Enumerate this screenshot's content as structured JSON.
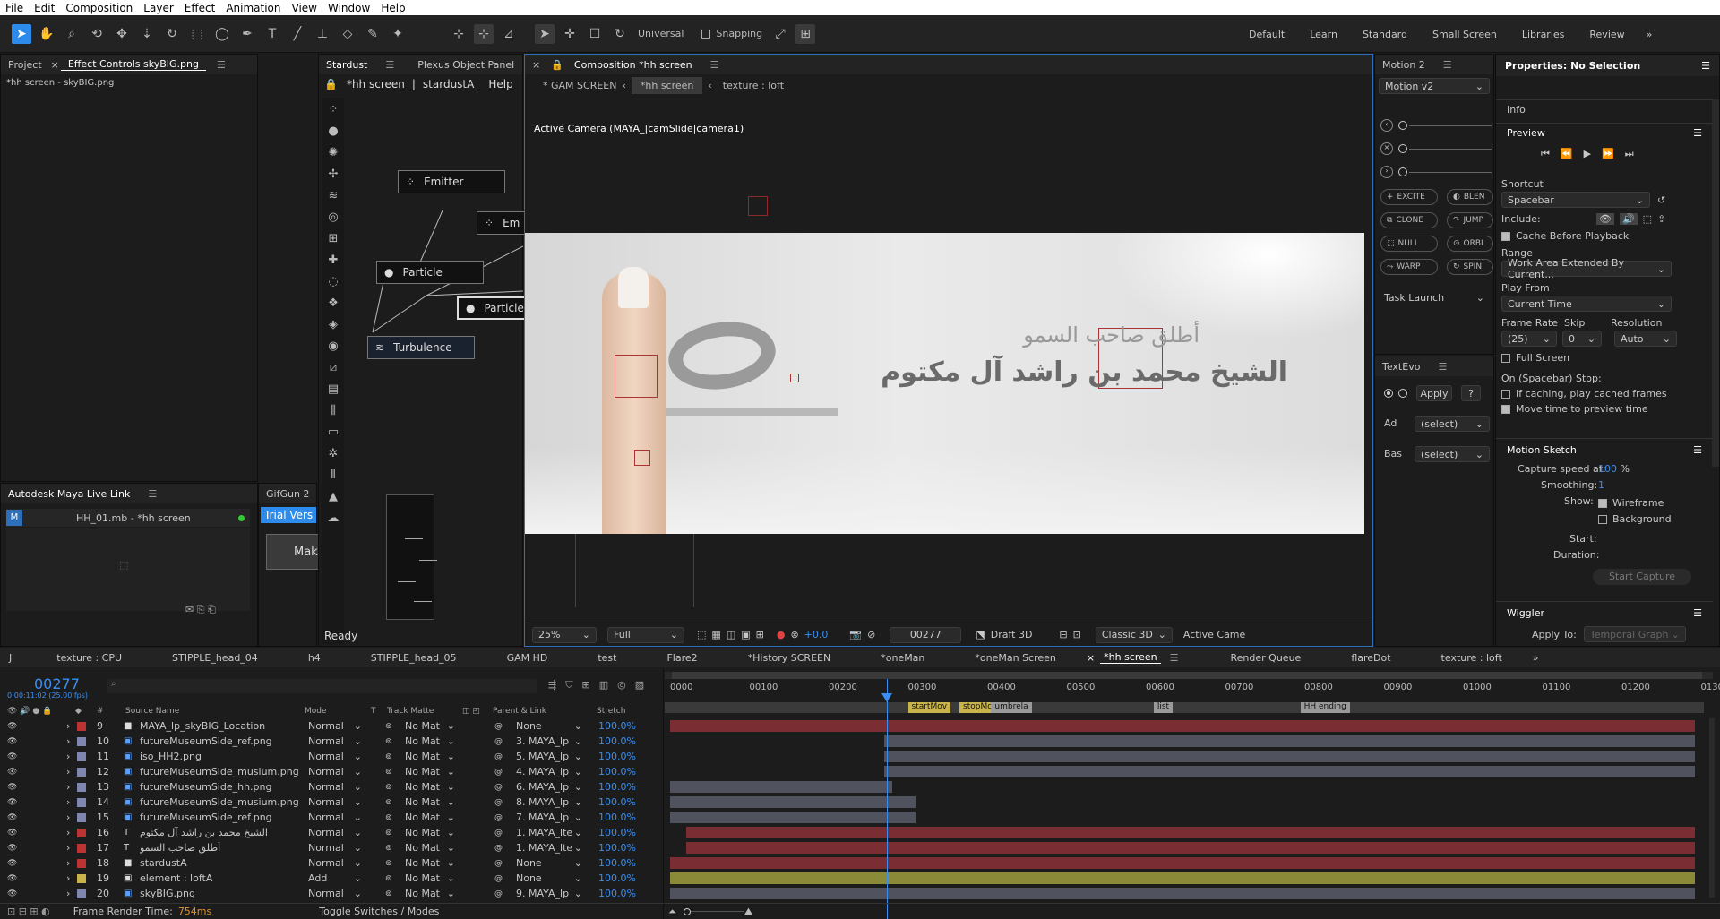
{
  "menu": [
    "File",
    "Edit",
    "Composition",
    "Layer",
    "Effect",
    "Animation",
    "View",
    "Window",
    "Help"
  ],
  "toolbar": {
    "universal": "Universal",
    "snapping": "Snapping"
  },
  "workspaces": [
    "Default",
    "Learn",
    "Standard",
    "Small Screen",
    "Libraries",
    "Review"
  ],
  "project_panel": {
    "tabs": [
      "Project",
      "Effect Controls skyBIG.png"
    ],
    "subtitle": "*hh screen - skyBIG.png"
  },
  "maya_panel": {
    "title": "Autodesk Maya Live Link",
    "item": "HH_01.mb - *hh screen"
  },
  "gifgun_panel": {
    "title": "GifGun 2",
    "trial": "Trial Vers",
    "make": "Mak"
  },
  "stardust_panel": {
    "tabs": [
      "Stardust",
      "Plexus Object Panel"
    ],
    "subtabs": [
      "*hh screen",
      "|",
      "stardustA",
      "Help"
    ],
    "nodes": [
      "Emitter",
      "Em",
      "Particle",
      "Particle",
      "Turbulence"
    ],
    "status": "Ready"
  },
  "comp_panel": {
    "title": "Composition *hh screen",
    "breadcrumbs": [
      "* GAM SCREEN",
      "*hh screen",
      "texture : loft"
    ],
    "camera": "Active Camera (MAYA_|camSlide|camera1)",
    "arabic_small": "أطلق صاحب السمو",
    "arabic_large": "الشيخ محمد بن راشد آل مكتوم",
    "footer": {
      "zoom": "25%",
      "quality": "Full",
      "exposure": "+0.0",
      "frame": "00277",
      "draft": "Draft 3D",
      "renderer": "Classic 3D",
      "camera": "Active Came"
    }
  },
  "motion_panel": {
    "title": "Motion 2",
    "preset": "Motion v2",
    "buttons": [
      "EXCITE",
      "BLEN",
      "CLONE",
      "JUMP",
      "NULL",
      "ORBI",
      "WARP",
      "SPIN"
    ],
    "task": "Task Launch"
  },
  "textevo_panel": {
    "title": "TextEvo",
    "apply": "Apply",
    "help": "?",
    "ad_label": "Ad",
    "bas_label": "Bas",
    "select": "(select)"
  },
  "properties_panel": {
    "title": "Properties: No Selection",
    "info": "Info",
    "preview": "Preview",
    "shortcut_label": "Shortcut",
    "shortcut": "Spacebar",
    "include": "Include:",
    "cache": "Cache Before Playback",
    "range_label": "Range",
    "range": "Work Area Extended By Current...",
    "playfrom_label": "Play From",
    "playfrom": "Current Time",
    "framerate_label": "Frame Rate",
    "skip_label": "Skip",
    "resolution_label": "Resolution",
    "framerate": "(25)",
    "skip": "0",
    "resolution": "Auto",
    "fullscreen": "Full Screen",
    "onstop": "On (Spacebar) Stop:",
    "ifcaching": "If caching, play cached frames",
    "movetime": "Move time to preview time",
    "motion_sketch": "Motion Sketch",
    "capture": "Capture speed at:",
    "capture_val": "100",
    "pct": "%",
    "smoothing": "Smoothing:",
    "smoothing_val": "1",
    "show": "Show:",
    "wireframe": "Wireframe",
    "background": "Background",
    "start": "Start:",
    "duration": "Duration:",
    "start_capture": "Start Capture",
    "wiggler": "Wiggler",
    "apply_to": "Apply To:",
    "apply_to_val": "Temporal Graph"
  },
  "timeline_tabs": [
    "texture : CPU",
    "STIPPLE_head_04",
    "h4",
    "STIPPLE_head_05",
    "GAM HD",
    "test",
    "Flare2",
    "*History SCREEN",
    "*oneMan",
    "*oneMan Screen",
    "*hh screen",
    "Render Queue",
    "flareDot",
    "texture : loft"
  ],
  "timeline": {
    "timecode": "00277",
    "timecode_sub": "0:00:11:02 (25.00 fps)",
    "search_placeholder": "Q~",
    "cols": [
      "#",
      "Source Name",
      "Mode",
      "T",
      "Track Matte",
      "Parent & Link",
      "Stretch"
    ],
    "ruler": [
      "0000",
      "00100",
      "00200",
      "00300",
      "00400",
      "00500",
      "00600",
      "00700",
      "00800",
      "00900",
      "01000",
      "01100",
      "01200",
      "0130"
    ],
    "markers": [
      "startMov",
      "stopMov",
      "umbrela",
      "list",
      "HH ending"
    ],
    "render_time_label": "Frame Render Time:",
    "render_time": "754ms",
    "toggle": "Toggle Switches / Modes"
  },
  "layers": [
    {
      "num": "9",
      "name": "MAYA_lp_skyBIG_Location",
      "mode": "Normal",
      "matte": "No Mat",
      "parent": "None",
      "stretch": "100.0%",
      "color": "#b33",
      "type": "solid"
    },
    {
      "num": "10",
      "name": "futureMuseumSide_ref.png",
      "mode": "Normal",
      "matte": "No Mat",
      "parent": "3. MAYA_lp",
      "stretch": "100.0%",
      "color": "#7f86b0",
      "type": "img"
    },
    {
      "num": "11",
      "name": "iso_HH2.png",
      "mode": "Normal",
      "matte": "No Mat",
      "parent": "5. MAYA_lp",
      "stretch": "100.0%",
      "color": "#7f86b0",
      "type": "img"
    },
    {
      "num": "12",
      "name": "futureMuseumSide_musium.png",
      "mode": "Normal",
      "matte": "No Mat",
      "parent": "4. MAYA_lp",
      "stretch": "100.0%",
      "color": "#7f86b0",
      "type": "img"
    },
    {
      "num": "13",
      "name": "futureMuseumSide_hh.png",
      "mode": "Normal",
      "matte": "No Mat",
      "parent": "6. MAYA_lp",
      "stretch": "100.0%",
      "color": "#7f86b0",
      "type": "img"
    },
    {
      "num": "14",
      "name": "futureMuseumSide_musium.png",
      "mode": "Normal",
      "matte": "No Mat",
      "parent": "8. MAYA_lp",
      "stretch": "100.0%",
      "color": "#7f86b0",
      "type": "img"
    },
    {
      "num": "15",
      "name": "futureMuseumSide_ref.png",
      "mode": "Normal",
      "matte": "No Mat",
      "parent": "7. MAYA_lp",
      "stretch": "100.0%",
      "color": "#7f86b0",
      "type": "img"
    },
    {
      "num": "16",
      "name": "الشيخ محمد بن راشد آل مكتوم",
      "mode": "Normal",
      "matte": "No Mat",
      "parent": "1. MAYA_lte",
      "stretch": "100.0%",
      "color": "#b33",
      "type": "text"
    },
    {
      "num": "17",
      "name": "أطلق صاحب السمو",
      "mode": "Normal",
      "matte": "No Mat",
      "parent": "1. MAYA_lte",
      "stretch": "100.0%",
      "color": "#b33",
      "type": "text"
    },
    {
      "num": "18",
      "name": "stardustA",
      "mode": "Normal",
      "matte": "No Mat",
      "parent": "None",
      "stretch": "100.0%",
      "color": "#b33",
      "type": "solid"
    },
    {
      "num": "19",
      "name": "element : loftA",
      "mode": "Add",
      "matte": "No Mat",
      "parent": "None",
      "stretch": "100.0%",
      "color": "#c8b44a",
      "type": "comp"
    },
    {
      "num": "20",
      "name": "skyBIG.png",
      "mode": "Normal",
      "matte": "No Mat",
      "parent": "9. MAYA_lp",
      "stretch": "100.0%",
      "color": "#7f86b0",
      "type": "img"
    }
  ],
  "colors": {
    "accent": "#2d8ceb",
    "red_bar": "#7a2e33",
    "grey_bar": "#50525e",
    "yellow_bar": "#8b8a38"
  }
}
